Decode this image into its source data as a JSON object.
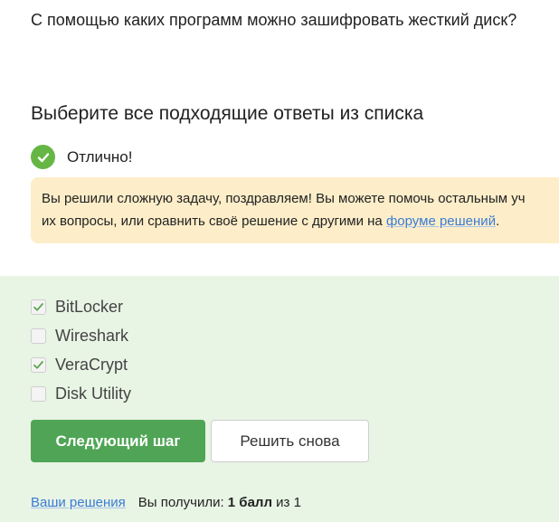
{
  "question": "С помощью каких программ можно зашифровать жесткий диск?",
  "prompt": "Выберите все подходящие ответы из списка",
  "result": {
    "icon": "check-circle-icon",
    "text": "Отлично!"
  },
  "notice": {
    "line1": "Вы решили сложную задачу, поздравляем! Вы можете помочь остальным уч",
    "line2_prefix": "их вопросы, или сравнить своё решение с другими на ",
    "link": "форуме решений",
    "line2_suffix": "."
  },
  "options": [
    {
      "label": "BitLocker",
      "checked": true
    },
    {
      "label": "Wireshark",
      "checked": false
    },
    {
      "label": "VeraCrypt",
      "checked": true
    },
    {
      "label": "Disk Utility",
      "checked": false
    }
  ],
  "buttons": {
    "next": "Следующий шаг",
    "retry": "Решить снова"
  },
  "footer": {
    "solutions_link": "Ваши решения",
    "score_prefix": "Вы получили: ",
    "score_value": "1 балл",
    "score_middle": " из ",
    "score_max": "1"
  },
  "colors": {
    "success": "#66b646",
    "primary_button": "#4fa555",
    "notice_bg": "#fdeec9",
    "answers_bg": "#e8f4e4",
    "link": "#3a7bd5"
  }
}
